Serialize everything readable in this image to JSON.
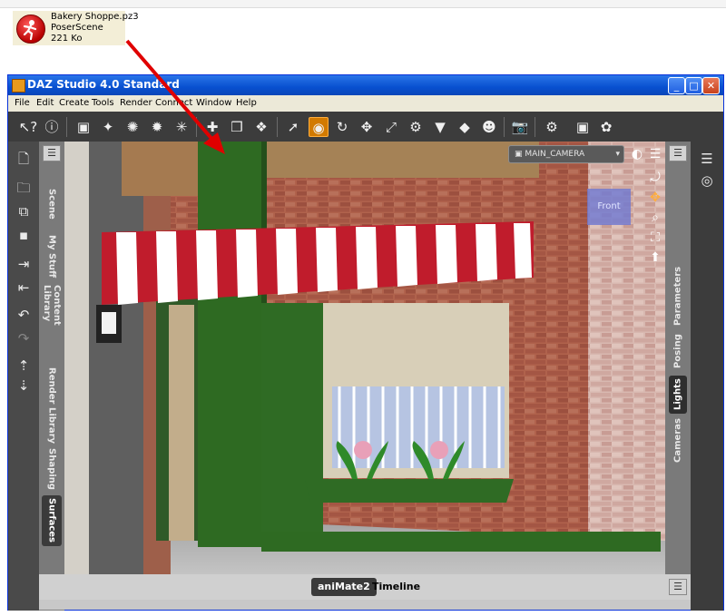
{
  "desktop_file": {
    "name": "Bakery Shoppe.pz3",
    "type": "PoserScene",
    "size": "221 Ko",
    "icon": "poser-runner-icon"
  },
  "window": {
    "title": "DAZ Studio 4.0 Standard",
    "controls": {
      "minimize": "_",
      "maximize": "□",
      "close": "✕"
    }
  },
  "menu": [
    "File",
    "Edit",
    "Create",
    "Tools",
    "Render",
    "Connect",
    "Window",
    "Help"
  ],
  "left_tabs": [
    "Scene",
    "My Stuff",
    "Content Library",
    "Render Library",
    "Shaping",
    "Surfaces"
  ],
  "right_tabs": [
    "Parameters",
    "Posing",
    "Lights",
    "Cameras"
  ],
  "viewport": {
    "camera": "MAIN_CAMERA",
    "view_cube_label": "Front"
  },
  "bottom_tabs": [
    "aniMate2",
    "Timeline"
  ],
  "colors": {
    "title_blue": "#0850d0",
    "toolbar_dark": "#3c3c3c",
    "active_tool_orange": "#d27a00",
    "annotation_arrow": "#e00000",
    "brick": "#a65a45",
    "awning_red": "#c01c2c"
  }
}
